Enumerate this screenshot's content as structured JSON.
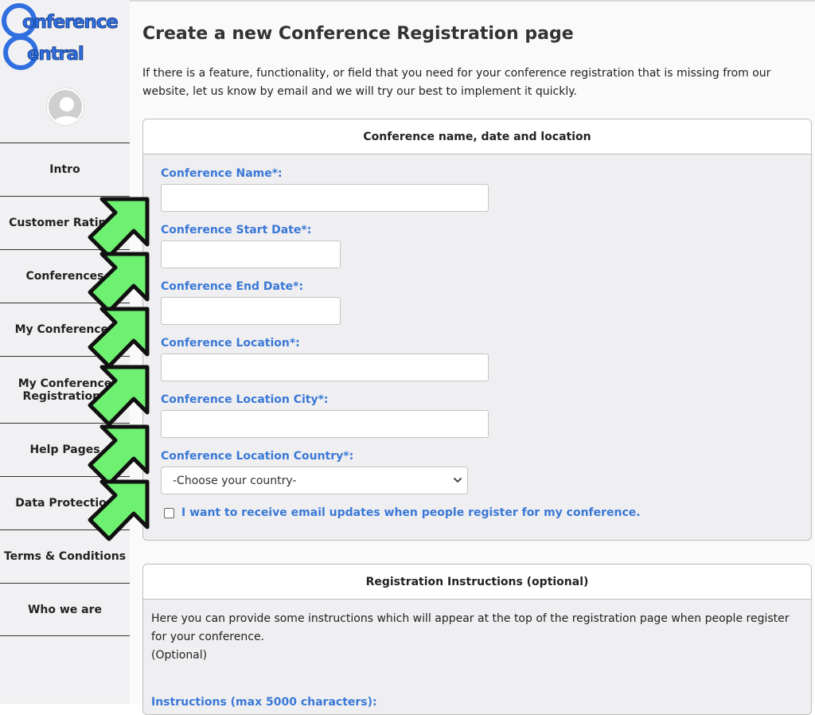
{
  "logo": {
    "line1": "onference",
    "line2": "entral"
  },
  "sidebar": {
    "items": [
      {
        "label": "Intro"
      },
      {
        "label": "Customer Ratings"
      },
      {
        "label": "Conferences"
      },
      {
        "label": "My Conferences"
      },
      {
        "label": "My Conference Registrations"
      },
      {
        "label": "Help Pages"
      },
      {
        "label": "Data Protection"
      },
      {
        "label": "Terms & Conditions"
      },
      {
        "label": "Who we are"
      }
    ]
  },
  "page": {
    "title": "Create a new Conference Registration page",
    "intro": "If there is a feature, functionality, or field that you need for your conference registration that is missing from our website, let us know by email and we will try our best to implement it quickly."
  },
  "section1": {
    "heading": "Conference name, date and location",
    "fields": {
      "name": "Conference Name*:",
      "start": "Conference Start Date*:",
      "end": "Conference End Date*:",
      "location": "Conference Location*:",
      "city": "Conference Location City*:",
      "country": "Conference Location Country*:"
    },
    "country_selected": "-Choose your country-",
    "email_updates_label": "I want to receive email updates when people register for my conference."
  },
  "section2": {
    "heading": "Registration Instructions (optional)",
    "description": "Here you can provide some instructions which will appear at the top of the registration page when people register for your conference.",
    "optional": "(Optional)",
    "instructions_label": "Instructions (max 5000 characters):"
  },
  "colors": {
    "accent": "#3a78d6",
    "arrow": "#6ef071",
    "logo": "#2f6fe0"
  },
  "icons": {
    "avatar": "user-avatar-icon",
    "select": "chevron-down-icon",
    "annotation": "arrow-annotation-icon"
  }
}
